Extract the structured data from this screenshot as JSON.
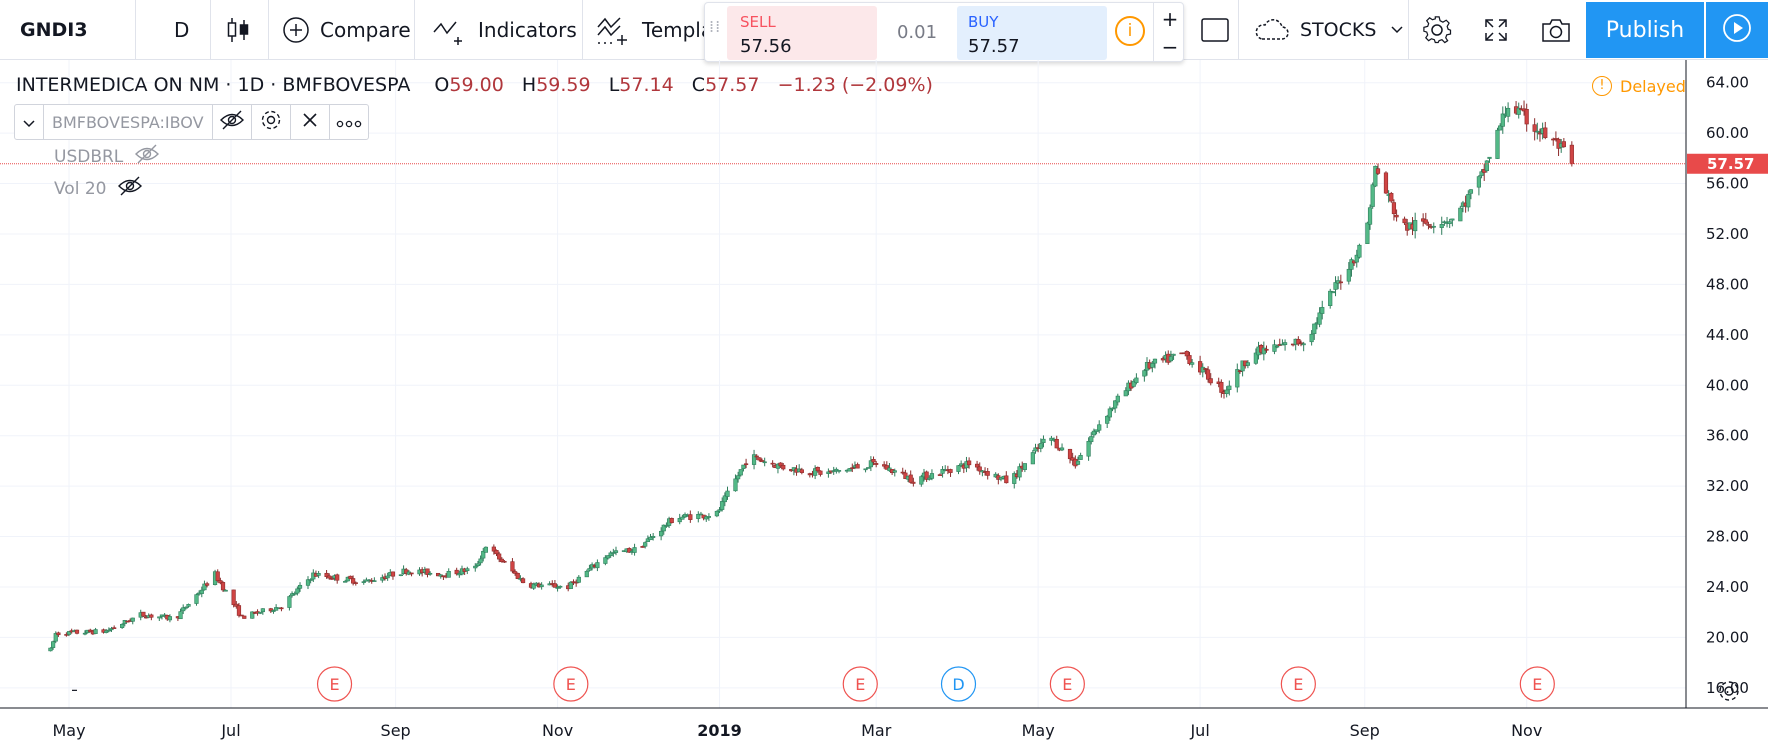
{
  "toolbar": {
    "symbol": "GNDI3",
    "interval": "D",
    "compare_label": "Compare",
    "indicators_label": "Indicators",
    "templates_label": "Templa",
    "layout_label": "STOCKS",
    "publish_label": "Publish"
  },
  "trade": {
    "sell_label": "SELL",
    "sell_price": "57.56",
    "spread": "0.01",
    "buy_label": "BUY",
    "buy_price": "57.57",
    "info_glyph": "i",
    "plus": "+",
    "minus": "−"
  },
  "legend": {
    "title": "INTERMEDICA ON NM · 1D · BMFBOVESPA",
    "open_label": "O",
    "open": "59.00",
    "high_label": "H",
    "high": "59.59",
    "low_label": "L",
    "low": "57.14",
    "close_label": "C",
    "close": "57.57",
    "change": "−1.23 (−2.09%)"
  },
  "indicators": {
    "ibov": "BMFBOVESPA:IBOV",
    "usdbrl": "USDBRL",
    "vol": "Vol 20"
  },
  "delayed_label": "Delayed",
  "icons": {
    "chart_type": "candlestick-icon",
    "compare": "plus-circle-icon",
    "indicators": "indicator-wave-icon",
    "templates": "template-icon",
    "rect": "rectangle-icon",
    "layout": "cloud-icon",
    "settings": "gear-icon",
    "fullscreen": "fullscreen-icon",
    "snapshot": "camera-icon",
    "play": "play-icon",
    "eye_hidden": "eye-off-icon"
  },
  "colors": {
    "up": "#26a69a",
    "up_fill": "#53b987",
    "down": "#ef5350",
    "down_fill": "#cf4444",
    "accent": "#2196f3",
    "warning": "#ff9800",
    "price_line": "#e84a4a"
  },
  "chart_data": {
    "type": "candlestick",
    "symbol": "INTERMEDICA ON NM",
    "exchange": "BMFBOVESPA",
    "last_price": "57.57",
    "price_axis": {
      "ticks": [
        "16.00",
        "20.00",
        "24.00",
        "28.00",
        "32.00",
        "36.00",
        "40.00",
        "44.00",
        "48.00",
        "52.00",
        "56.00",
        "60.00",
        "64.00"
      ],
      "range": [
        14.4,
        65.8
      ]
    },
    "time_axis": {
      "ticks": [
        {
          "label": "May",
          "date": "2018-05-01"
        },
        {
          "label": "Jul",
          "date": "2018-07-01"
        },
        {
          "label": "Sep",
          "date": "2018-09-01"
        },
        {
          "label": "Nov",
          "date": "2018-11-01"
        },
        {
          "label": "2019",
          "date": "2019-01-01",
          "bold": true
        },
        {
          "label": "Mar",
          "date": "2019-03-01"
        },
        {
          "label": "May",
          "date": "2019-05-01"
        },
        {
          "label": "Jul",
          "date": "2019-07-01"
        },
        {
          "label": "Sep",
          "date": "2019-09-01"
        },
        {
          "label": "Nov",
          "date": "2019-11-01"
        }
      ],
      "range": [
        "2018-04-05",
        "2019-12-31"
      ]
    },
    "events": [
      {
        "type": "E",
        "date": "2018-08-09"
      },
      {
        "type": "E",
        "date": "2018-11-06"
      },
      {
        "type": "E",
        "date": "2019-02-23"
      },
      {
        "type": "D",
        "date": "2019-04-01"
      },
      {
        "type": "E",
        "date": "2019-05-12"
      },
      {
        "type": "E",
        "date": "2019-08-07"
      },
      {
        "type": "E",
        "date": "2019-11-05"
      }
    ],
    "price_path": [
      {
        "date": "2018-04-24",
        "price": 19.0
      },
      {
        "date": "2018-04-26",
        "price": 20.3
      },
      {
        "date": "2018-05-15",
        "price": 20.5
      },
      {
        "date": "2018-05-28",
        "price": 21.8
      },
      {
        "date": "2018-06-10",
        "price": 21.5
      },
      {
        "date": "2018-06-25",
        "price": 25.0
      },
      {
        "date": "2018-07-05",
        "price": 21.6
      },
      {
        "date": "2018-07-20",
        "price": 22.5
      },
      {
        "date": "2018-08-01",
        "price": 25.0
      },
      {
        "date": "2018-08-20",
        "price": 24.4
      },
      {
        "date": "2018-09-05",
        "price": 25.3
      },
      {
        "date": "2018-09-20",
        "price": 25.0
      },
      {
        "date": "2018-10-01",
        "price": 25.5
      },
      {
        "date": "2018-10-05",
        "price": 27.3
      },
      {
        "date": "2018-10-20",
        "price": 24.2
      },
      {
        "date": "2018-11-05",
        "price": 24.0
      },
      {
        "date": "2018-11-20",
        "price": 26.6
      },
      {
        "date": "2018-12-01",
        "price": 27.0
      },
      {
        "date": "2018-12-15",
        "price": 29.5
      },
      {
        "date": "2018-12-31",
        "price": 29.8
      },
      {
        "date": "2019-01-12",
        "price": 34.4
      },
      {
        "date": "2019-01-25",
        "price": 33.5
      },
      {
        "date": "2019-02-10",
        "price": 33.0
      },
      {
        "date": "2019-03-01",
        "price": 33.8
      },
      {
        "date": "2019-03-15",
        "price": 32.5
      },
      {
        "date": "2019-04-05",
        "price": 33.8
      },
      {
        "date": "2019-04-20",
        "price": 32.3
      },
      {
        "date": "2019-05-05",
        "price": 36.0
      },
      {
        "date": "2019-05-15",
        "price": 33.8
      },
      {
        "date": "2019-05-25",
        "price": 37.3
      },
      {
        "date": "2019-06-10",
        "price": 41.4
      },
      {
        "date": "2019-06-25",
        "price": 42.5
      },
      {
        "date": "2019-07-10",
        "price": 39.5
      },
      {
        "date": "2019-07-20",
        "price": 42.5
      },
      {
        "date": "2019-08-10",
        "price": 43.6
      },
      {
        "date": "2019-08-20",
        "price": 47.5
      },
      {
        "date": "2019-09-01",
        "price": 51.5
      },
      {
        "date": "2019-09-05",
        "price": 57.2
      },
      {
        "date": "2019-09-15",
        "price": 52.5
      },
      {
        "date": "2019-10-05",
        "price": 53.3
      },
      {
        "date": "2019-10-15",
        "price": 56.5
      },
      {
        "date": "2019-10-25",
        "price": 62.3
      },
      {
        "date": "2019-11-05",
        "price": 60.3
      },
      {
        "date": "2019-11-13",
        "price": 59.0
      },
      {
        "date": "2019-11-18",
        "price": 57.57
      }
    ]
  }
}
